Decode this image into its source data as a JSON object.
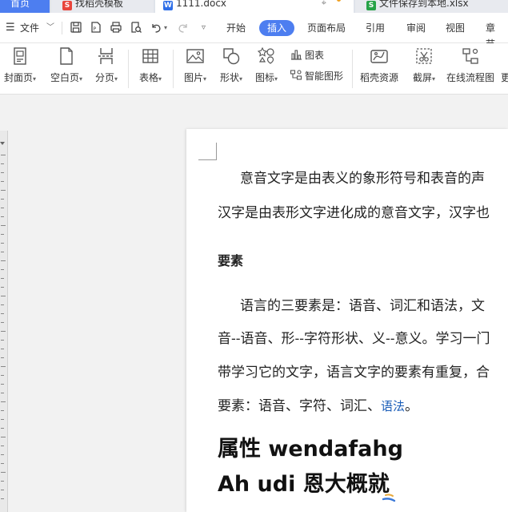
{
  "tabs": {
    "home": "首页",
    "template": "找稻壳模板",
    "doc": "1111.docx",
    "xlsx": "文件保存到本地.xlsx"
  },
  "menubar": {
    "file": "文件",
    "tabs": [
      "开始",
      "插入",
      "页面布局",
      "引用",
      "审阅",
      "视图",
      "章节"
    ],
    "active_tab": "插入"
  },
  "ribbon": {
    "cover": "封面页",
    "blank": "空白页",
    "pagebreak": "分页",
    "table": "表格",
    "picture": "图片",
    "shape": "形状",
    "icon": "图标",
    "chart": "图表",
    "smartart": "智能图形",
    "docer": "稻壳资源",
    "screenshot": "截屏",
    "flowchart": "在线流程图",
    "more": "更"
  },
  "document": {
    "p1_line1": "意音文字是由表义的象形符号和表音的声",
    "p1_line2": "汉字是由表形文字进化成的意音文字，汉字也",
    "heading": "要素",
    "p2_line1": "语言的三要素是：语音、词汇和语法，文",
    "p2_line2": "音--语音、形--字符形状、义--意义。学习一门",
    "p2_line3": "带学习它的文字，语言文字的要素有重复，合",
    "p2_line4_prefix": "要素：语音、字符、词汇、",
    "p2_line4_link": "语法",
    "p2_line4_suffix": "。",
    "big_line1": "属性 wendafahg",
    "big_line2": "Ah udi 恩大概就"
  },
  "colors": {
    "accent": "#4d7ef0",
    "tabbar": "#dfe3ea",
    "link": "#1a5db8"
  }
}
